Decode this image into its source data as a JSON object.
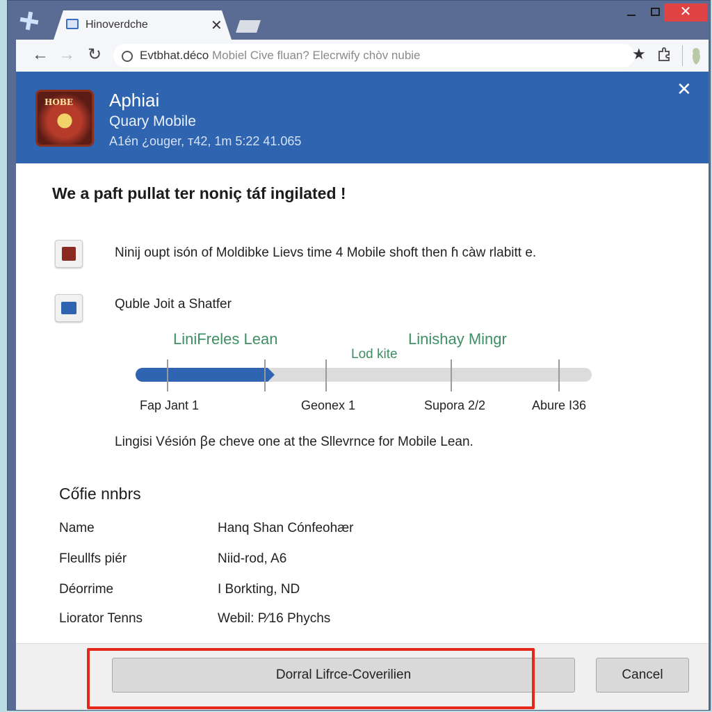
{
  "browser": {
    "tab_title": "Hinoverdche",
    "tab_close": "✕",
    "url_host": "Evtbhat.déco",
    "url_rest": " Mobiel Cive fluan? Elecrwify chòv nubie",
    "window_close": "✕"
  },
  "banner": {
    "title": "Aphiai",
    "subtitle": "Quary Mobile",
    "meta": "A1én ¿ouger, т42, 1m 5:22 41.065",
    "icon_text": "HOBE",
    "close": "✕"
  },
  "headline": "We a paft pullat ter noniç táf ingilated !",
  "features": [
    {
      "text": "Ninij oupt isón of Moldibke Lievs time 4 Mobile shoft then ɦ càw rlabitt e."
    },
    {
      "text": "Quble Joit a Shatfer"
    }
  ],
  "timeline": {
    "label_a": "LiniFreles Lean",
    "label_b": "Linishay Mingr",
    "label_c": "Lod kite",
    "progress_fraction": 0.29,
    "ticks": [
      "Fap Jant 1",
      "Geonex 1",
      "Supora 2/2",
      "Abure I36"
    ]
  },
  "lead_text": "Lingisi Vésión ꞵe cheve one at the Sllevrnce for Mobile Lean.",
  "details": {
    "title": "Cőfie nnbrs",
    "rows": [
      {
        "key": "Name",
        "value": "Hanq Shan Cónfeohær"
      },
      {
        "key": "Fleullfs piér",
        "value": "Niid-rod, A6"
      },
      {
        "key": "Déorrime",
        "value": "I Borkting, ND"
      },
      {
        "key": "Liorator Tenns",
        "value": "Webil: P⁄16 Phychs"
      }
    ]
  },
  "footer": {
    "primary_label": "Dorral Lifrce-Coverilien",
    "cancel_label": "Cancel"
  },
  "colors": {
    "brand_blue": "#2f64b0",
    "highlight_red": "#e4281c",
    "timeline_green": "#3e8f63"
  },
  "icons": {
    "back": "back-arrow-icon",
    "forward": "forward-arrow-icon",
    "reload": "reload-icon",
    "star": "bookmark-star-icon",
    "extension": "puzzle-icon"
  }
}
